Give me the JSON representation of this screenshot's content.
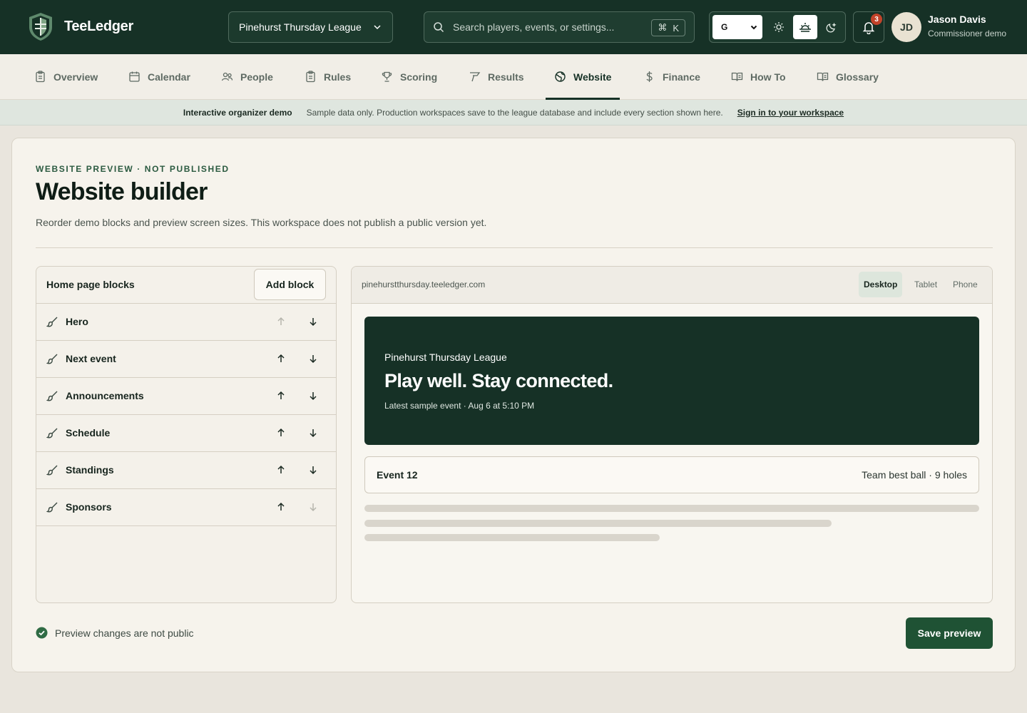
{
  "app": {
    "name": "TeeLedger",
    "league": "Pinehurst Thursday League",
    "search_placeholder": "Search players, events, or settings...",
    "shortcut_symbol": "⌘",
    "shortcut_key": "K",
    "mode_select_value": "G",
    "notification_count": "3",
    "user": {
      "initials": "JD",
      "name": "Jason Davis",
      "role": "Commissioner demo"
    }
  },
  "nav": {
    "items": [
      {
        "label": "Overview",
        "icon": "clipboard-icon"
      },
      {
        "label": "Calendar",
        "icon": "calendar-icon"
      },
      {
        "label": "People",
        "icon": "people-icon"
      },
      {
        "label": "Rules",
        "icon": "clipboard-icon"
      },
      {
        "label": "Scoring",
        "icon": "trophy-icon"
      },
      {
        "label": "Results",
        "icon": "flag-icon"
      },
      {
        "label": "Website",
        "icon": "globe-icon",
        "active": true
      },
      {
        "label": "Finance",
        "icon": "dollar-icon"
      },
      {
        "label": "How To",
        "icon": "book-icon"
      },
      {
        "label": "Glossary",
        "icon": "book-icon"
      }
    ]
  },
  "banner": {
    "title": "Interactive organizer demo",
    "text": "Sample data only. Production workspaces save to the league database and include every section shown here.",
    "link": "Sign in to your workspace"
  },
  "page": {
    "eyebrow": "WEBSITE PREVIEW · NOT PUBLISHED",
    "title": "Website builder",
    "description": "Reorder demo blocks and preview screen sizes. This workspace does not publish a public version yet."
  },
  "blocks": {
    "title": "Home page blocks",
    "add_label": "Add block",
    "items": [
      {
        "label": "Hero"
      },
      {
        "label": "Next event"
      },
      {
        "label": "Announcements"
      },
      {
        "label": "Schedule"
      },
      {
        "label": "Standings"
      },
      {
        "label": "Sponsors"
      }
    ]
  },
  "preview": {
    "url": "pinehurstthursday.teeledger.com",
    "devices": [
      "Desktop",
      "Tablet",
      "Phone"
    ],
    "active_device": "Desktop",
    "hero": {
      "league": "Pinehurst Thursday League",
      "headline": "Play well. Stay connected.",
      "sub": "Latest sample event · Aug 6 at 5:10 PM"
    },
    "event": {
      "name": "Event 12",
      "meta": "Team best ball · 9 holes"
    }
  },
  "footer": {
    "status": "Preview changes are not public",
    "save_label": "Save preview"
  },
  "colors": {
    "brand_dark": "#163126",
    "accent_green": "#1f5234",
    "notification": "#c2432a"
  }
}
